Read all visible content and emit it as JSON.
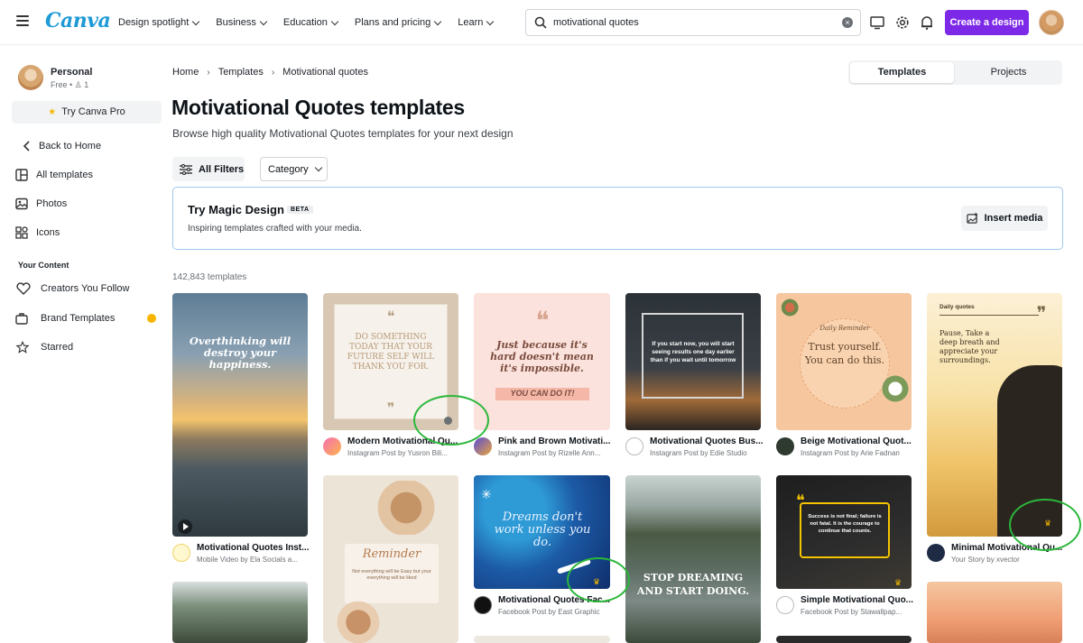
{
  "header": {
    "logo": "Canva",
    "nav": [
      "Design spotlight",
      "Business",
      "Education",
      "Plans and pricing",
      "Learn"
    ],
    "search_value": "motivational quotes",
    "clear_glyph": "×",
    "create_label": "Create a design",
    "accent": "#7d2ae8"
  },
  "sidebar": {
    "profile_name": "Personal",
    "profile_sub": "Free • ♙ 1",
    "try_pro": "Try Canva Pro",
    "back": "Back to Home",
    "items": [
      "All templates",
      "Photos",
      "Icons"
    ],
    "your_content": "Your Content",
    "content_items": [
      "Creators You Follow",
      "Brand Templates",
      "Starred"
    ]
  },
  "breadcrumb": [
    "Home",
    "Templates",
    "Motivational quotes"
  ],
  "toggle": [
    "Templates",
    "Projects"
  ],
  "title": "Motivational Quotes templates",
  "subtitle": "Browse high quality Motivational Quotes templates for your next design",
  "filters": {
    "all": "All Filters",
    "category": "Category"
  },
  "magic": {
    "title": "Try Magic Design",
    "badge": "BETA",
    "subtitle": "Inspiring templates crafted with your media.",
    "insert": "Insert media"
  },
  "count": "142,843 templates",
  "cards": [
    {
      "title": "Motivational Quotes Inst...",
      "sub": "Mobile Video by Ela Socials a...",
      "text": "Overthinking will destroy your happiness."
    },
    {
      "title": "Modern Motivational Qu...",
      "sub": "Instagram Post by Yusron Bili...",
      "text": "DO SOMETHING TODAY THAT YOUR FUTURE SELF WILL THANK YOU FOR."
    },
    {
      "title": "Pink and Brown Motivati...",
      "sub": "Instagram Post by Rizelle Ann...",
      "text": "Just because it's hard doesn't mean it's impossible.",
      "extra": "YOU CAN DO IT!"
    },
    {
      "title": "Motivational Quotes Bus...",
      "sub": "Instagram Post by Edie Studio",
      "text": "If you start now, you will start seeing results one day earlier than if you wait until tomorrow"
    },
    {
      "title": "Beige Motivational Quot...",
      "sub": "Instagram Post by Arie Fadnan",
      "eyebrow": "Daily Reminder",
      "text": "Trust yourself. You can do this."
    },
    {
      "title": "Minimal Motivational Qu...",
      "sub": "Your Story by xvector",
      "eyebrow": "Daily quotes",
      "text": "Pause, Take a deep breath and appreciate your surroundings."
    },
    {
      "text": "Reminder",
      "extra": "Not everything will be Easy but your everything will be liked"
    },
    {
      "title": "Motivational Quotes Fac...",
      "sub": "Facebook Post by East Graphic",
      "text": "Dreams don't work unless you do."
    },
    {
      "text": "STOP DREAMING AND START DOING."
    },
    {
      "title": "Simple Motivational Quo...",
      "sub": "Facebook Post by Stawallpap...",
      "text": "Success is not final; failure is not fatal. It is the courage to continue that counts."
    }
  ]
}
